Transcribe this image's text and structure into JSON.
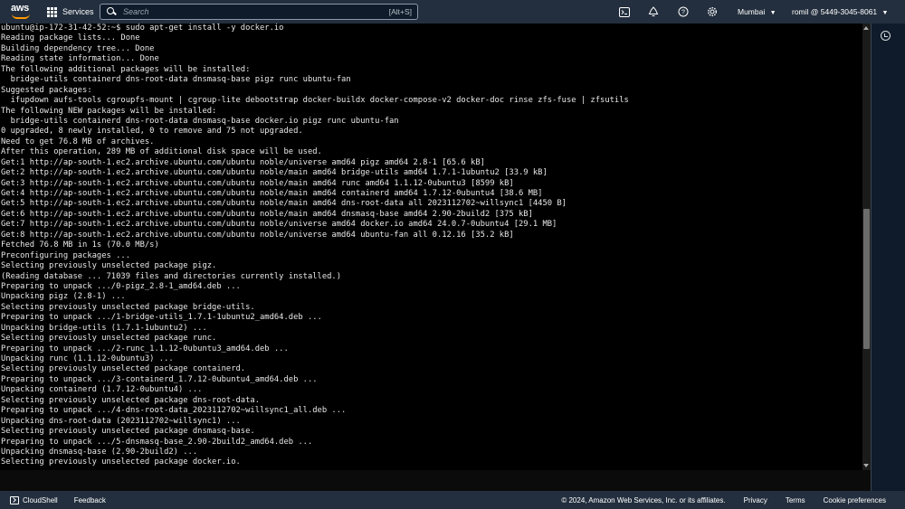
{
  "topbar": {
    "logo_text": "aws",
    "services_label": "Services",
    "search_placeholder": "Search",
    "search_shortcut": "[Alt+S]",
    "icons": [
      "cloudshell-icon",
      "bell-icon",
      "help-icon",
      "gear-icon"
    ],
    "region": "Mumbai",
    "account": "romil @ 5449-3045-8061",
    "colors": {
      "bar": "#232f3e",
      "accent": "#ff9900"
    }
  },
  "terminal": {
    "lines": [
      "ubuntu@ip-172-31-42-52:~$ sudo apt-get install -y docker.io",
      "Reading package lists... Done",
      "Building dependency tree... Done",
      "Reading state information... Done",
      "The following additional packages will be installed:",
      "  bridge-utils containerd dns-root-data dnsmasq-base pigz runc ubuntu-fan",
      "Suggested packages:",
      "  ifupdown aufs-tools cgroupfs-mount | cgroup-lite debootstrap docker-buildx docker-compose-v2 docker-doc rinse zfs-fuse | zfsutils",
      "The following NEW packages will be installed:",
      "  bridge-utils containerd dns-root-data dnsmasq-base docker.io pigz runc ubuntu-fan",
      "0 upgraded, 8 newly installed, 0 to remove and 75 not upgraded.",
      "Need to get 76.8 MB of archives.",
      "After this operation, 289 MB of additional disk space will be used.",
      "Get:1 http://ap-south-1.ec2.archive.ubuntu.com/ubuntu noble/universe amd64 pigz amd64 2.8-1 [65.6 kB]",
      "Get:2 http://ap-south-1.ec2.archive.ubuntu.com/ubuntu noble/main amd64 bridge-utils amd64 1.7.1-1ubuntu2 [33.9 kB]",
      "Get:3 http://ap-south-1.ec2.archive.ubuntu.com/ubuntu noble/main amd64 runc amd64 1.1.12-0ubuntu3 [8599 kB]",
      "Get:4 http://ap-south-1.ec2.archive.ubuntu.com/ubuntu noble/main amd64 containerd amd64 1.7.12-0ubuntu4 [38.6 MB]",
      "Get:5 http://ap-south-1.ec2.archive.ubuntu.com/ubuntu noble/main amd64 dns-root-data all 2023112702~willsync1 [4450 B]",
      "Get:6 http://ap-south-1.ec2.archive.ubuntu.com/ubuntu noble/main amd64 dnsmasq-base amd64 2.90-2build2 [375 kB]",
      "Get:7 http://ap-south-1.ec2.archive.ubuntu.com/ubuntu noble/universe amd64 docker.io amd64 24.0.7-0ubuntu4 [29.1 MB]",
      "Get:8 http://ap-south-1.ec2.archive.ubuntu.com/ubuntu noble/universe amd64 ubuntu-fan all 0.12.16 [35.2 kB]",
      "Fetched 76.8 MB in 1s (70.0 MB/s)",
      "Preconfiguring packages ...",
      "Selecting previously unselected package pigz.",
      "(Reading database ... 71039 files and directories currently installed.)",
      "Preparing to unpack .../0-pigz_2.8-1_amd64.deb ...",
      "Unpacking pigz (2.8-1) ...",
      "Selecting previously unselected package bridge-utils.",
      "Preparing to unpack .../1-bridge-utils_1.7.1-1ubuntu2_amd64.deb ...",
      "Unpacking bridge-utils (1.7.1-1ubuntu2) ...",
      "Selecting previously unselected package runc.",
      "Preparing to unpack .../2-runc_1.1.12-0ubuntu3_amd64.deb ...",
      "Unpacking runc (1.1.12-0ubuntu3) ...",
      "Selecting previously unselected package containerd.",
      "Preparing to unpack .../3-containerd_1.7.12-0ubuntu4_amd64.deb ...",
      "Unpacking containerd (1.7.12-0ubuntu4) ...",
      "Selecting previously unselected package dns-root-data.",
      "Preparing to unpack .../4-dns-root-data_2023112702~willsync1_all.deb ...",
      "Unpacking dns-root-data (2023112702~willsync1) ...",
      "Selecting previously unselected package dnsmasq-base.",
      "Preparing to unpack .../5-dnsmasq-base_2.90-2build2_amd64.deb ...",
      "Unpacking dnsmasq-base (2.90-2build2) ...",
      "Selecting previously unselected package docker.io."
    ]
  },
  "footer": {
    "cloudshell_label": "CloudShell",
    "feedback_label": "Feedback",
    "copyright": "© 2024, Amazon Web Services, Inc. or its affiliates.",
    "privacy_label": "Privacy",
    "terms_label": "Terms",
    "cookie_label": "Cookie preferences"
  }
}
